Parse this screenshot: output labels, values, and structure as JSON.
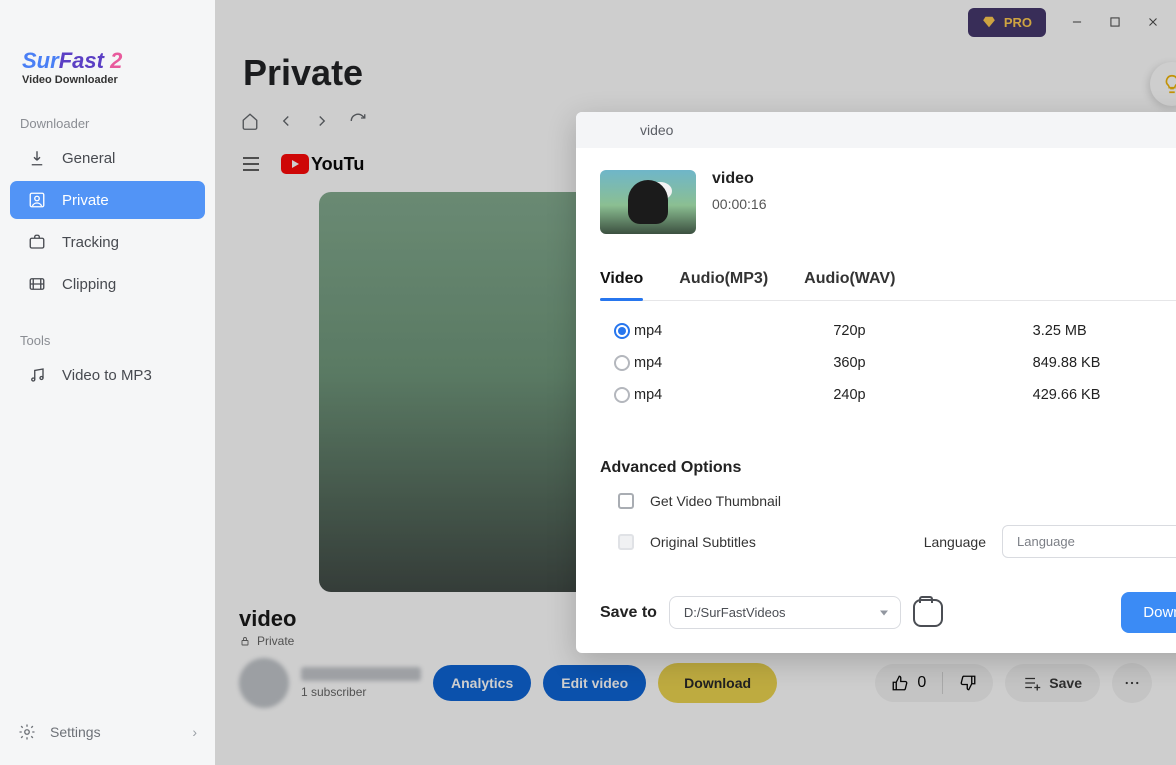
{
  "app": {
    "logo_parts": {
      "sur": "Sur",
      "fast": "Fast",
      "two": "2"
    },
    "logo_sub": "Video Downloader",
    "pro": "PRO"
  },
  "sidebar": {
    "section1": "Downloader",
    "items": [
      {
        "label": "General"
      },
      {
        "label": "Private"
      },
      {
        "label": "Tracking"
      },
      {
        "label": "Clipping"
      }
    ],
    "section2": "Tools",
    "tools": [
      {
        "label": "Video to MP3"
      }
    ],
    "settings": "Settings"
  },
  "page": {
    "title": "Private"
  },
  "youtube": {
    "brand": "YouTu",
    "video_title": "video",
    "privacy": "Private",
    "subscribers": "1 subscriber",
    "analytics": "Analytics",
    "edit": "Edit video",
    "download": "Download",
    "likes": "0",
    "save": "Save"
  },
  "dialog": {
    "header": "video",
    "name": "video",
    "duration": "00:00:16",
    "tabs": [
      "Video",
      "Audio(MP3)",
      "Audio(WAV)"
    ],
    "formats": [
      {
        "fmt": "mp4",
        "res": "720p",
        "size": "3.25 MB",
        "selected": true
      },
      {
        "fmt": "mp4",
        "res": "360p",
        "size": "849.88 KB",
        "selected": false
      },
      {
        "fmt": "mp4",
        "res": "240p",
        "size": "429.66 KB",
        "selected": false
      }
    ],
    "advanced_title": "Advanced Options",
    "opt_thumbnail": "Get Video Thumbnail",
    "opt_subtitles": "Original Subtitles",
    "language_label": "Language",
    "language_placeholder": "Language",
    "save_to_label": "Save to",
    "save_path": "D:/SurFastVideos",
    "download_btn": "Download"
  }
}
